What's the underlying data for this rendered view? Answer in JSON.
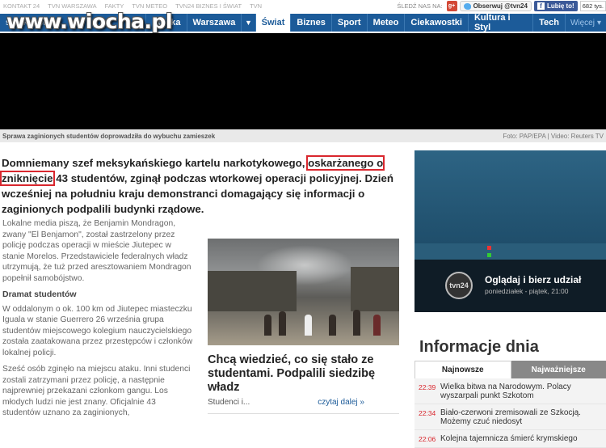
{
  "topbar": {
    "links": [
      "KONTAKT 24",
      "TVN WARSZAWA",
      "FAKTY",
      "TVN METEO",
      "TVN24 BIZNES I ŚWIAT",
      "TVN"
    ],
    "follow_label": "ŚLEDŹ NAS NA:",
    "gplus": "g+",
    "twitter_label": "Obserwuj @tvn24",
    "facebook_label": "Lubię to!",
    "facebook_count": "682 tys."
  },
  "watermark": "www.wiocha.pl",
  "nav": {
    "first": "Start  Kraj  Świat",
    "items": [
      "Polska",
      "Warszawa",
      "Świat",
      "Biznes",
      "Sport",
      "Meteo",
      "Ciekawostki",
      "Kultura i Styl",
      "Tech"
    ],
    "more": "Więcej"
  },
  "caption": {
    "text": "Sprawa zaginionych studentów doprowadziła do wybuchu zamieszek",
    "credit": "Foto: PAP/EPA | Video: Reuters TV"
  },
  "lead": {
    "p1": "Domniemany szef meksykańskiego kartelu narkotykowego, ",
    "h1": "oskarżanego o",
    "p2": " ",
    "h2": "zniknięcie",
    "p3": " 43 studentów, zginął podczas wtorkowej operacji policyjnej. Dzień wcześniej na południu kraju demonstranci domagający się informacji o zaginionych podpalili budynki rządowe."
  },
  "body": {
    "para1": "Lokalne media piszą, że Benjamin Mondragon, zwany \"El Benjamon\", został zastrzelony przez policję podczas operacji w mieście Jiutepec w stanie Morelos. Przedstawiciele federalnych władz utrzymują, że tuż przed aresztowaniem Mondragon popełnił samobójstwo.",
    "heading": "Dramat studentów",
    "para2": "W oddalonym o ok. 100 km od Jiutepec miasteczku Iguala w stanie Guerrero 26 września grupa studentów miejscowego kolegium nauczycielskiego została zaatakowana przez przestępców i członków lokalnej policji.",
    "para3": "Sześć osób zginęło na miejscu ataku. Inni studenci zostali zatrzymani przez policję, a następnie najprewniej przekazani członkom gangu. Los młodych ludzi nie jest znany. Oficjalnie 43 studentów uznano za zaginionych,"
  },
  "card": {
    "title": "Chcą wiedzieć, co się stało ze studentami. Podpalili siedzibę władz",
    "snippet": "Studenci i...",
    "more": "czytaj dalej »"
  },
  "ad": {
    "logo": "tvn24",
    "line1": "Oglądaj i bierz udział",
    "line2": "poniedziałek - piątek, 21:00"
  },
  "info": {
    "title": "Informacje dnia",
    "tab1": "Najnowsze",
    "tab2": "Najważniejsze",
    "news": [
      {
        "time": "22:39",
        "text": "Wielka bitwa na Narodowym. Polacy wyszarpali punkt Szkotom"
      },
      {
        "time": "22:34",
        "text": "Biało-czerwoni zremisowali ze Szkocją. Możemy czuć niedosyt"
      },
      {
        "time": "22:06",
        "text": "Kolejna tajemnicza śmierć krymskiego"
      }
    ]
  },
  "colors": {
    "nav": "#1c5b99",
    "highlight": "#d9272e",
    "time": "#d9272e"
  }
}
